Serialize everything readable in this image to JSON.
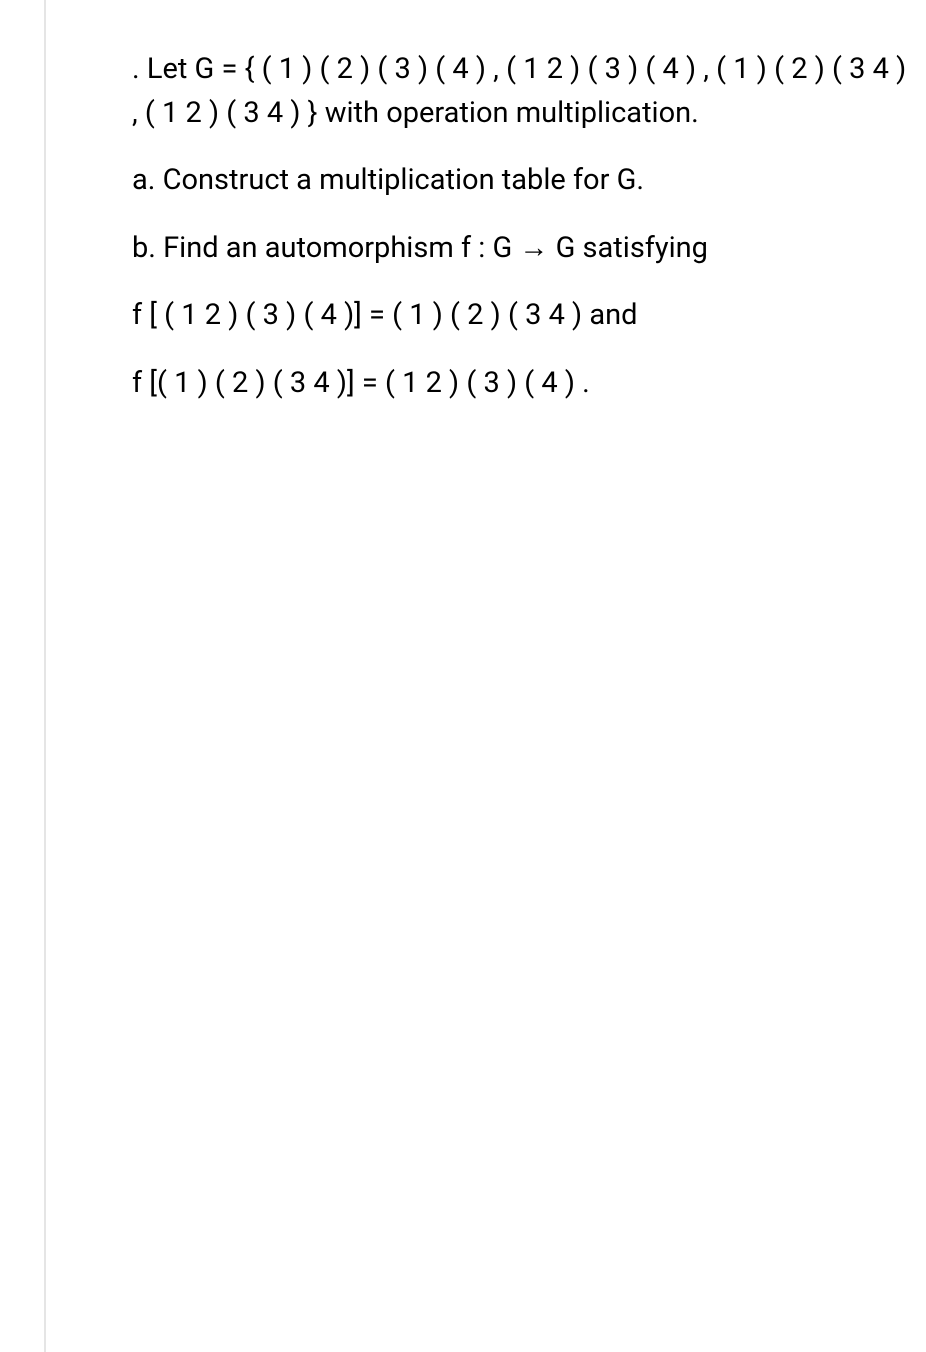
{
  "problem": {
    "intro": ". Let G = { ( 1 ) ( 2 ) ( 3 ) ( 4 ) , ( 1 2 ) ( 3 ) ( 4 ) , ( 1 ) ( 2 ) ( 3 4 ) , ( 1 2 ) ( 3 4 ) } with operation multiplication.",
    "part_a": "a. Construct a multiplication table for G.",
    "part_b": "b. Find an automorphism f : G → G satisfying",
    "condition_1": "f [ ( 1 2 ) ( 3 ) ( 4 )] = ( 1 ) ( 2 ) ( 3 4 ) and",
    "condition_2": "f [( 1 ) ( 2 ) ( 3 4 )] = ( 1 2 ) ( 3 ) ( 4 ) ."
  }
}
